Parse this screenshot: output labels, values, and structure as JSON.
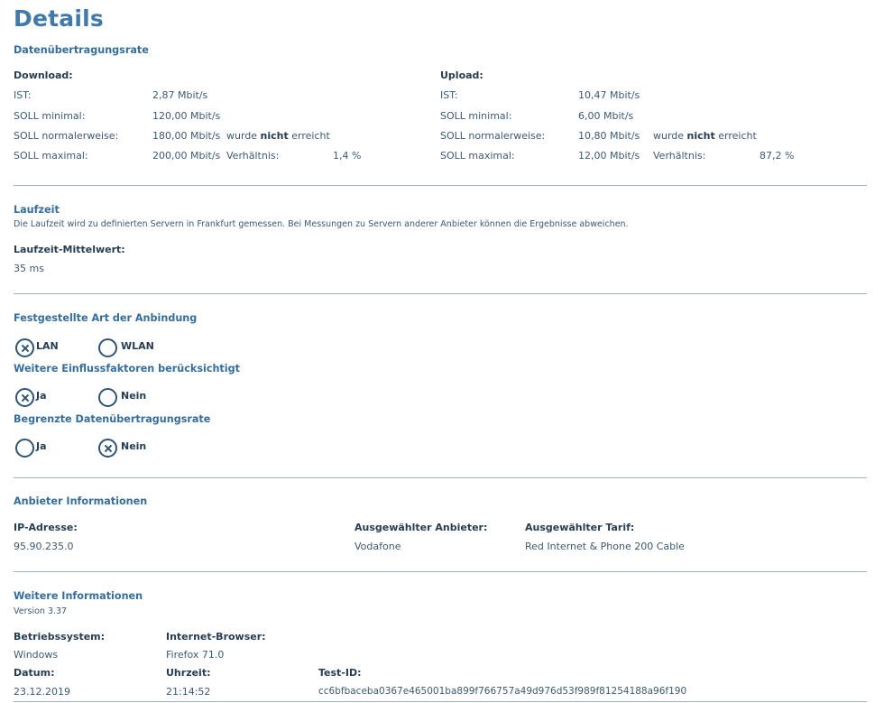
{
  "page_title": "Details",
  "transfer_rate": {
    "heading": "Datenübertragungsrate",
    "download": {
      "heading": "Download:",
      "ist_label": "IST:",
      "ist_value": "2,87 Mbit/s",
      "min_label": "SOLL minimal:",
      "min_value": "120,00 Mbit/s",
      "normal_label": "SOLL normalerweise:",
      "normal_value": "180,00 Mbit/s",
      "status_pre": "wurde ",
      "status_bold": "nicht",
      "status_post": " erreicht",
      "max_label": "SOLL maximal:",
      "max_value": "200,00 Mbit/s",
      "ratio_label": "Verhältnis:",
      "ratio_value": "1,4 %"
    },
    "upload": {
      "heading": "Upload:",
      "ist_label": "IST:",
      "ist_value": "10,47 Mbit/s",
      "min_label": "SOLL minimal:",
      "min_value": "6,00 Mbit/s",
      "normal_label": "SOLL normalerweise:",
      "normal_value": "10,80 Mbit/s",
      "status_pre": "wurde ",
      "status_bold": "nicht",
      "status_post": " erreicht",
      "max_label": "SOLL maximal:",
      "max_value": "12,00 Mbit/s",
      "ratio_label": "Verhältnis:",
      "ratio_value": "87,2 %"
    }
  },
  "latency": {
    "heading": "Laufzeit",
    "description": "Die Laufzeit wird zu definierten Servern in Frankfurt gemessen. Bei Messungen zu Servern anderer Anbieter können die Ergebnisse abweichen.",
    "mean_label": "Laufzeit-Mittelwert:",
    "mean_value": "35 ms"
  },
  "connection": {
    "heading": "Festgestellte Art der Anbindung",
    "options": [
      {
        "label": "LAN",
        "checked": true
      },
      {
        "label": "WLAN",
        "checked": false
      }
    ]
  },
  "influences": {
    "heading": "Weitere Einflussfaktoren berücksichtigt",
    "options": [
      {
        "label": "Ja",
        "checked": true
      },
      {
        "label": "Nein",
        "checked": false
      }
    ]
  },
  "limited_rate": {
    "heading": "Begrenzte Datenübertragungsrate",
    "options": [
      {
        "label": "Ja",
        "checked": false
      },
      {
        "label": "Nein",
        "checked": true
      }
    ]
  },
  "provider": {
    "heading": "Anbieter Informationen",
    "ip_label": "IP-Adresse:",
    "ip_value": "95.90.235.0",
    "provider_label": "Ausgewählter Anbieter:",
    "provider_value": "Vodafone",
    "tariff_label": "Ausgewählter Tarif:",
    "tariff_value": "Red Internet & Phone 200 Cable"
  },
  "more": {
    "heading": "Weitere Informationen",
    "version": "Version 3.37",
    "os_label": "Betriebssystem:",
    "os_value": "Windows",
    "browser_label": "Internet-Browser:",
    "browser_value": "Firefox 71.0",
    "date_label": "Datum:",
    "date_value": "23.12.2019",
    "time_label": "Uhrzeit:",
    "time_value": "21:14:52",
    "testid_label": "Test-ID:",
    "testid_value": "cc6bfbaceba0367e465001ba899f766757a49d976d53f989f81254188a96f190"
  },
  "colors": {
    "title": "#3f7aab",
    "section_heading": "#356e9d",
    "label": "#263d52",
    "text": "#3d5a73",
    "divider": "#9fb2c2",
    "radio": "#2e5575"
  }
}
